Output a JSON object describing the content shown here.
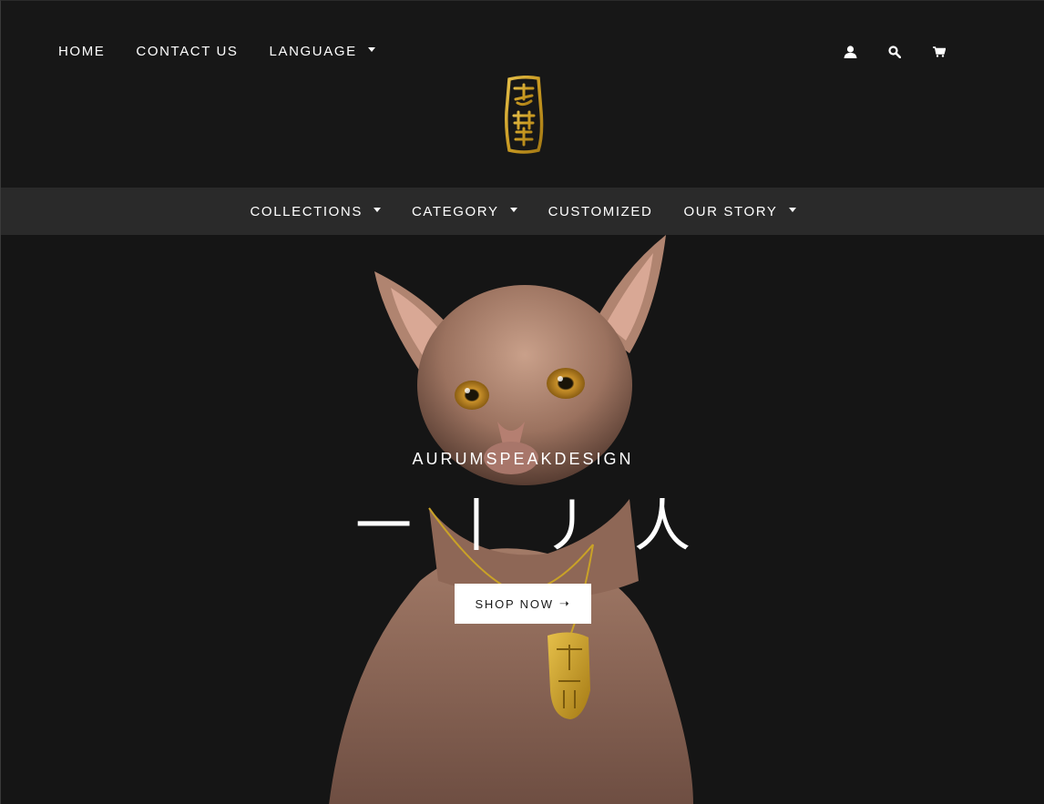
{
  "topnav": {
    "home": "HOME",
    "contact": "CONTACT US",
    "language": "LANGUAGE"
  },
  "utility_icons": [
    "account-icon",
    "search-icon",
    "cart-icon"
  ],
  "subnav": {
    "collections": "COLLECTIONS",
    "category": "CATEGORY",
    "customized": "CUSTOMIZED",
    "our_story": "OUR STORY"
  },
  "hero": {
    "brand": "AURUMSPEAKDESIGN",
    "kanji": "一丨丿人",
    "cta": "SHOP NOW"
  },
  "colors": {
    "background": "#161616",
    "subnav_bg": "#2a2a2a",
    "gold": "#c9a227",
    "text": "#ffffff"
  }
}
